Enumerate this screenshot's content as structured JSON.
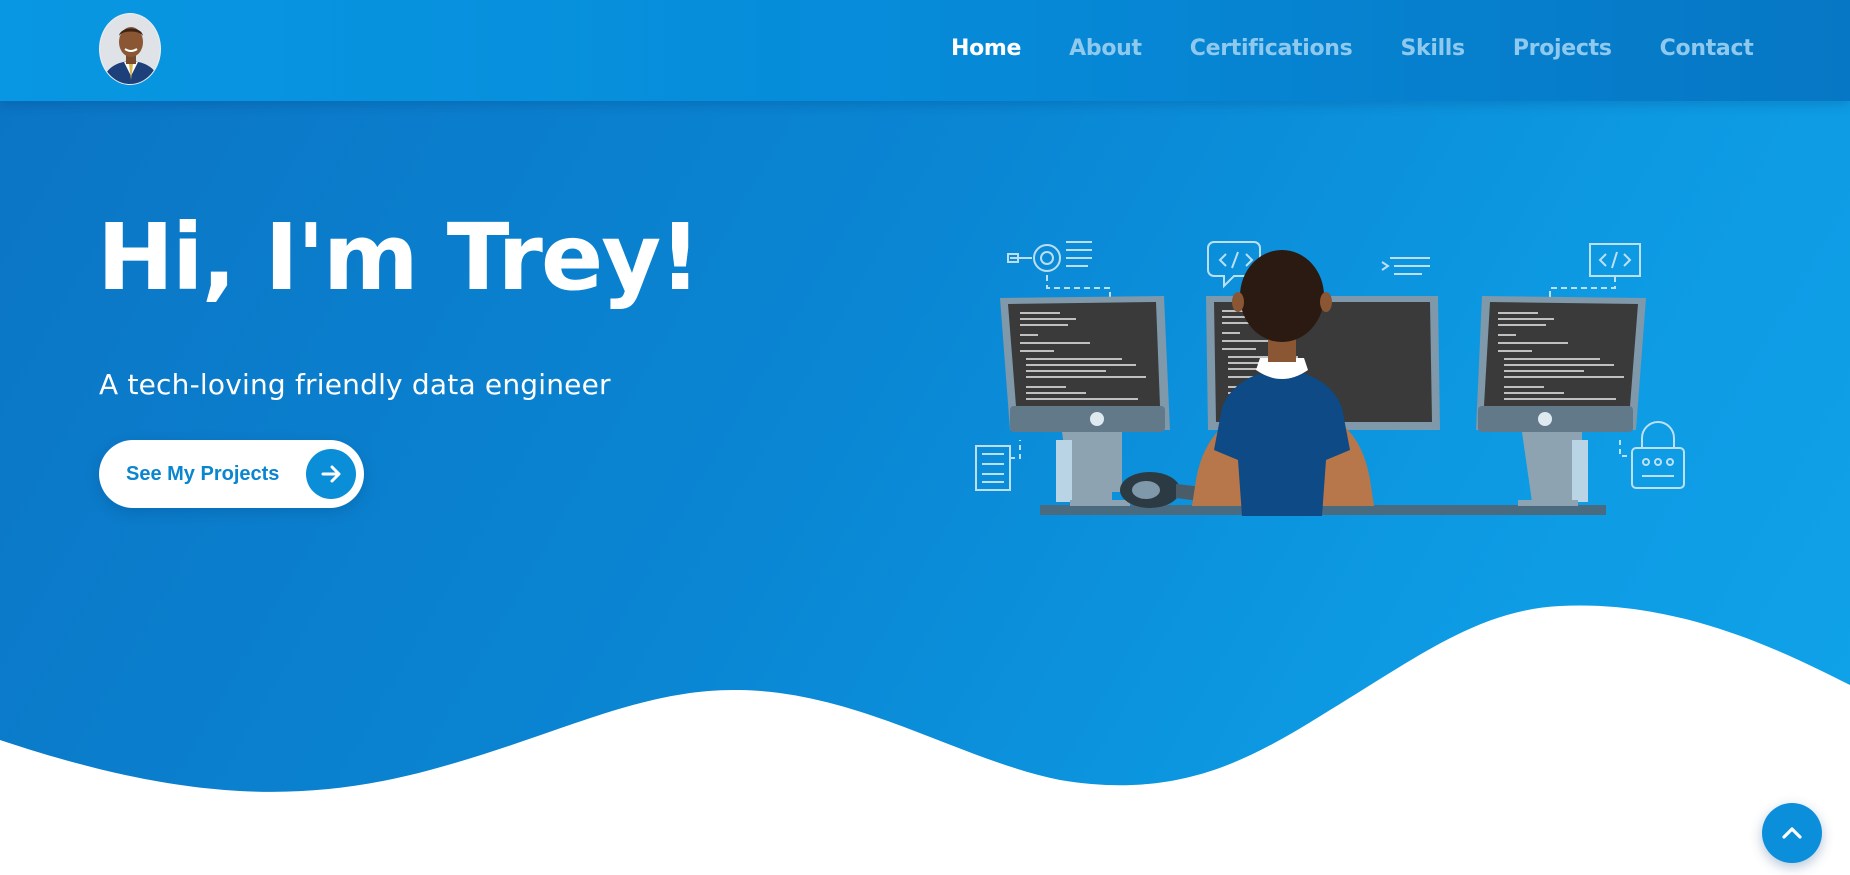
{
  "nav": {
    "avatar_icon": "profile-photo",
    "links": [
      {
        "label": "Home",
        "active": true
      },
      {
        "label": "About",
        "active": false
      },
      {
        "label": "Certifications",
        "active": false
      },
      {
        "label": "Skills",
        "active": false
      },
      {
        "label": "Projects",
        "active": false
      },
      {
        "label": "Contact",
        "active": false
      }
    ]
  },
  "hero": {
    "title": "Hi, I'm Trey!",
    "subtitle": "A tech-loving friendly data engineer",
    "cta_label": "See My Projects",
    "cta_icon": "arrow-right-icon",
    "illustration": "developer-at-computers-illustration"
  },
  "scroll_top": {
    "icon": "chevron-up-icon"
  },
  "colors": {
    "primary_blue": "#0a86d3",
    "nav_inactive": "#8fc9ee",
    "white": "#ffffff",
    "button_text": "#0a85cf"
  }
}
